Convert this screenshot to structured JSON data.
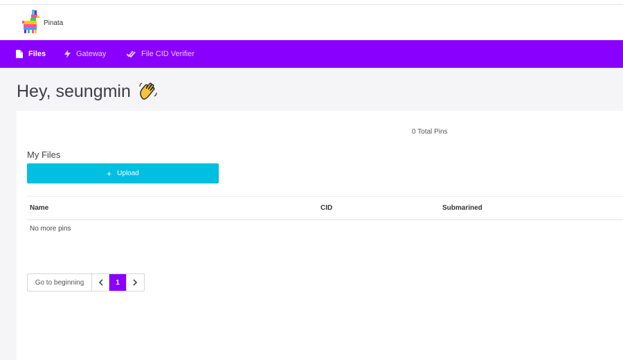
{
  "brand": {
    "name": "Pinata",
    "logo_icon": "pinata-llama-logo"
  },
  "nav": {
    "items": [
      {
        "label": "Files",
        "icon": "file-icon",
        "active": true
      },
      {
        "label": "Gateway",
        "icon": "lightning-icon",
        "active": false
      },
      {
        "label": "File CID Verifier",
        "icon": "double-check-icon",
        "active": false
      }
    ]
  },
  "greeting": {
    "text": "Hey, seungmin",
    "emoji_icon": "waving-hand-icon"
  },
  "files": {
    "total_pins": "0 Total Pins",
    "section_title": "My Files",
    "upload_label": "Upload",
    "columns": [
      "Name",
      "CID",
      "Submarined"
    ],
    "empty_message": "No more pins"
  },
  "pagination": {
    "begin_label": "Go to beginning",
    "prev_icon": "chevron-left-icon",
    "current_page": "1",
    "next_icon": "chevron-right-icon"
  },
  "colors": {
    "nav_bg": "#8a00ff",
    "upload_bg": "#00bfe0",
    "page_bg": "#f5f5f8"
  }
}
